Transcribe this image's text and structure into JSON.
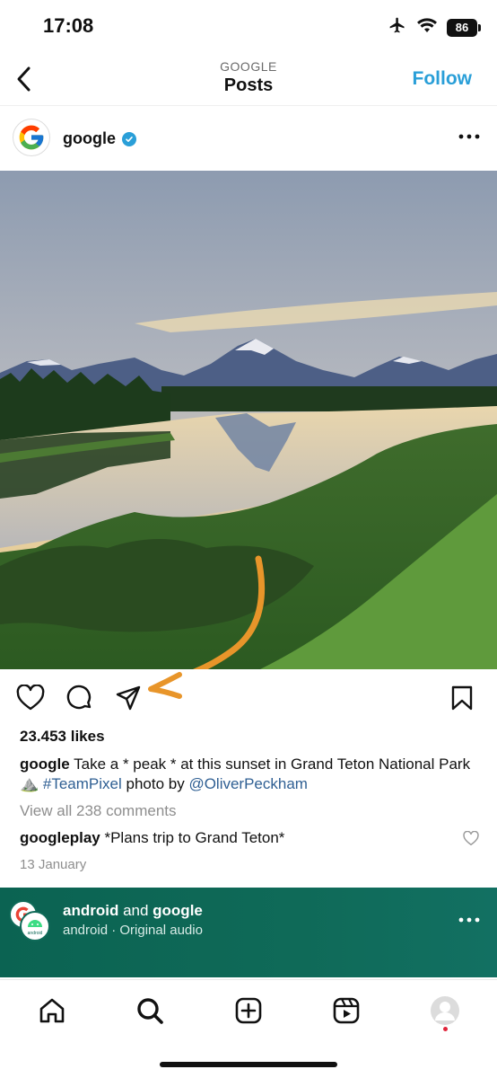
{
  "status_bar": {
    "time": "17:08",
    "battery": "86"
  },
  "header": {
    "subtitle": "GOOGLE",
    "title": "Posts",
    "follow_label": "Follow"
  },
  "post": {
    "username": "google",
    "likes": "23.453 likes",
    "caption_user": "google",
    "caption_text": " Take a * peak * at this sunset in Grand Teton National Park ⛰️ ",
    "caption_hashtag": "#TeamPixel",
    "caption_mid": " photo by ",
    "caption_mention": "@OliverPeckham",
    "view_comments": "View all 238 comments",
    "comment_user": "googleplay",
    "comment_text": " *Plans trip to Grand Teton*",
    "date": "13 January"
  },
  "next_post": {
    "user1": "android",
    "joiner": " and ",
    "user2": "google",
    "audio": "android · Original audio",
    "avatar_text": "android"
  },
  "icons": {
    "back": "chevron-left-icon",
    "verified": "verified-badge-icon",
    "more": "more-horizontal-icon",
    "like": "heart-icon",
    "comment": "comment-icon",
    "share": "paper-plane-icon",
    "save": "bookmark-icon",
    "annotation": "orange-arrow-annotation",
    "tabs": [
      "home-icon",
      "search-icon",
      "create-icon",
      "reels-icon",
      "profile-avatar"
    ]
  },
  "colors": {
    "accent_blue": "#2a9fd8",
    "hashtag_blue": "#2f5f93",
    "next_post_green": "#0f6a58",
    "arrow_orange": "#e8952a",
    "notification_red": "#e0243b"
  }
}
